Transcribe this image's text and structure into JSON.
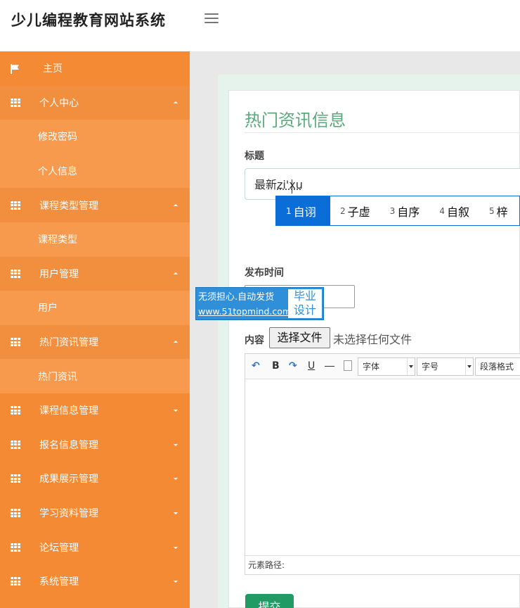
{
  "header": {
    "title": "少儿编程教育网站系统"
  },
  "sidebar": {
    "items": [
      {
        "label": "主页"
      },
      {
        "label": "个人中心"
      },
      {
        "label": "修改密码"
      },
      {
        "label": "个人信息"
      },
      {
        "label": "课程类型管理"
      },
      {
        "label": "课程类型"
      },
      {
        "label": "用户管理"
      },
      {
        "label": "用户"
      },
      {
        "label": "热门资讯管理"
      },
      {
        "label": "热门资讯"
      },
      {
        "label": "课程信息管理"
      },
      {
        "label": "报名信息管理"
      },
      {
        "label": "成果展示管理"
      },
      {
        "label": "学习资料管理"
      },
      {
        "label": "论坛管理"
      },
      {
        "label": "系统管理"
      }
    ]
  },
  "form": {
    "page_title": "热门资讯信息",
    "title_label": "标题",
    "title_value_prefix": "最新",
    "title_value_pinyin": "zi'xu",
    "publish_time_label": "发布时间",
    "content_label": "内容",
    "file_button": "选择文件",
    "file_status": "未选择任何文件",
    "submit_label": "提交"
  },
  "ime": {
    "candidates": [
      {
        "num": "1",
        "text": "自诩"
      },
      {
        "num": "2",
        "text": "子虚"
      },
      {
        "num": "3",
        "text": "自序"
      },
      {
        "num": "4",
        "text": "自叙"
      },
      {
        "num": "5",
        "text": "梓"
      }
    ]
  },
  "watermark": {
    "line1": "无须担心.自动发货",
    "line2": "www.51topmind.com",
    "badge_line1": "毕业",
    "badge_line2": "设计"
  },
  "editor": {
    "toolbar": {
      "bold": "B",
      "underline": "U",
      "font_select": "字体",
      "size_select": "字号",
      "paragraph_select": "段落格式"
    },
    "status_path": "元素路径:"
  },
  "colors": {
    "sidebar": "#f48a33",
    "sidebar_sub": "#f79a4d",
    "title_green": "#5aa97a",
    "submit_green": "#229a64",
    "ime_blue": "#0b6ed8"
  }
}
